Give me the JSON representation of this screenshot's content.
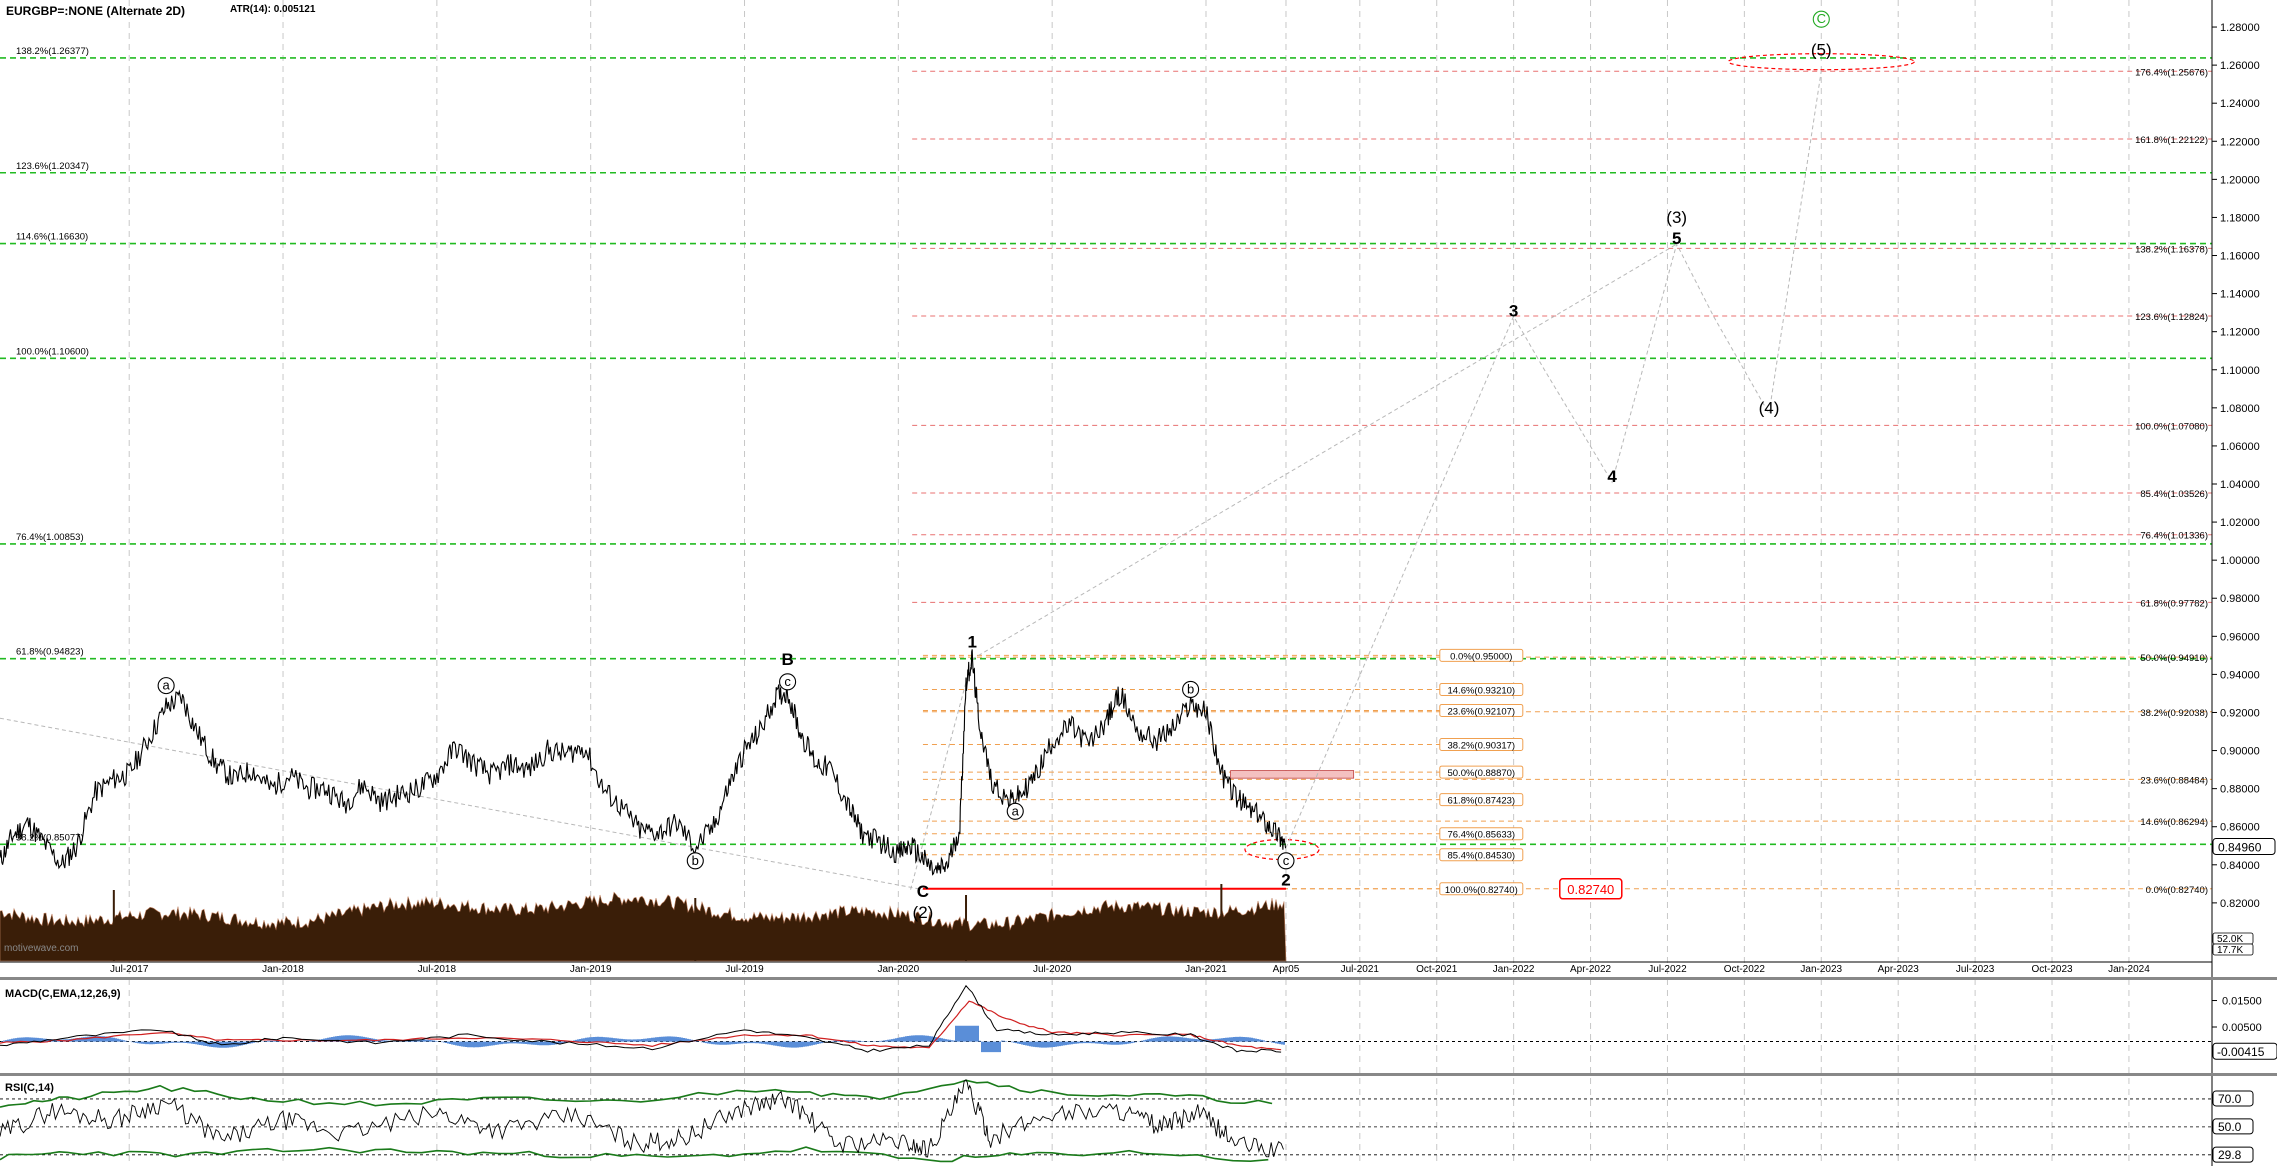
{
  "header": {
    "symbol": "EURGBP=:NONE (Alternate 2D)",
    "atr": "ATR(14): 0.005121",
    "watermark": "motivewave.com"
  },
  "chart_data": [
    {
      "type": "line",
      "panel": "price",
      "ylim": [
        0.79,
        1.29
      ],
      "y_ticks": [
        "0.82000",
        "0.84000",
        "0.86000",
        "0.88000",
        "0.90000",
        "0.92000",
        "0.94000",
        "0.96000",
        "0.98000",
        "1.00000",
        "1.02000",
        "1.04000",
        "1.06000",
        "1.08000",
        "1.10000",
        "1.12000",
        "1.14000",
        "1.16000",
        "1.18000",
        "1.20000",
        "1.22000",
        "1.24000",
        "1.26000",
        "1.28000"
      ],
      "x_ticks": [
        {
          "label": "Jul-2017",
          "t": 2017.5
        },
        {
          "label": "Jan-2018",
          "t": 2018.0
        },
        {
          "label": "Jul-2018",
          "t": 2018.5
        },
        {
          "label": "Jan-2019",
          "t": 2019.0
        },
        {
          "label": "Jul-2019",
          "t": 2019.5
        },
        {
          "label": "Jan-2020",
          "t": 2020.0
        },
        {
          "label": "Jul-2020",
          "t": 2020.5
        },
        {
          "label": "Jan-2021",
          "t": 2021.0
        },
        {
          "label": "Apr05",
          "t": 2021.26
        },
        {
          "label": "Jul-2021",
          "t": 2021.5
        },
        {
          "label": "Oct-2021",
          "t": 2021.75
        },
        {
          "label": "Jan-2022",
          "t": 2022.0
        },
        {
          "label": "Apr-2022",
          "t": 2022.25
        },
        {
          "label": "Jul-2022",
          "t": 2022.5
        },
        {
          "label": "Oct-2022",
          "t": 2022.75
        },
        {
          "label": "Jan-2023",
          "t": 2023.0
        },
        {
          "label": "Apr-2023",
          "t": 2023.25
        },
        {
          "label": "Jul-2023",
          "t": 2023.5
        },
        {
          "label": "Oct-2023",
          "t": 2023.75
        },
        {
          "label": "Jan-2024",
          "t": 2024.0
        }
      ],
      "xlim": [
        2017.08,
        2024.27
      ],
      "price_path": [
        [
          2017.08,
          0.842
        ],
        [
          2017.12,
          0.855
        ],
        [
          2017.17,
          0.862
        ],
        [
          2017.22,
          0.852
        ],
        [
          2017.28,
          0.84
        ],
        [
          2017.33,
          0.85
        ],
        [
          2017.39,
          0.878
        ],
        [
          2017.45,
          0.885
        ],
        [
          2017.5,
          0.888
        ],
        [
          2017.56,
          0.905
        ],
        [
          2017.62,
          0.923
        ],
        [
          2017.67,
          0.928
        ],
        [
          2017.72,
          0.91
        ],
        [
          2017.78,
          0.893
        ],
        [
          2017.84,
          0.885
        ],
        [
          2017.9,
          0.89
        ],
        [
          2017.96,
          0.88
        ],
        [
          2018.02,
          0.887
        ],
        [
          2018.08,
          0.88
        ],
        [
          2018.14,
          0.88
        ],
        [
          2018.2,
          0.872
        ],
        [
          2018.26,
          0.882
        ],
        [
          2018.32,
          0.873
        ],
        [
          2018.38,
          0.877
        ],
        [
          2018.44,
          0.88
        ],
        [
          2018.5,
          0.887
        ],
        [
          2018.56,
          0.902
        ],
        [
          2018.62,
          0.893
        ],
        [
          2018.68,
          0.887
        ],
        [
          2018.74,
          0.893
        ],
        [
          2018.8,
          0.89
        ],
        [
          2018.86,
          0.9
        ],
        [
          2018.92,
          0.898
        ],
        [
          2018.98,
          0.902
        ],
        [
          2019.04,
          0.88
        ],
        [
          2019.1,
          0.87
        ],
        [
          2019.16,
          0.858
        ],
        [
          2019.22,
          0.857
        ],
        [
          2019.28,
          0.862
        ],
        [
          2019.34,
          0.849
        ],
        [
          2019.4,
          0.86
        ],
        [
          2019.45,
          0.882
        ],
        [
          2019.5,
          0.9
        ],
        [
          2019.55,
          0.91
        ],
        [
          2019.6,
          0.928
        ],
        [
          2019.64,
          0.931
        ],
        [
          2019.68,
          0.91
        ],
        [
          2019.73,
          0.894
        ],
        [
          2019.78,
          0.89
        ],
        [
          2019.84,
          0.87
        ],
        [
          2019.88,
          0.857
        ],
        [
          2019.94,
          0.852
        ],
        [
          2020.0,
          0.846
        ],
        [
          2020.04,
          0.85
        ],
        [
          2020.08,
          0.843
        ],
        [
          2020.12,
          0.836
        ],
        [
          2020.16,
          0.84
        ],
        [
          2020.2,
          0.86
        ],
        [
          2020.22,
          0.936
        ],
        [
          2020.24,
          0.948
        ],
        [
          2020.26,
          0.918
        ],
        [
          2020.3,
          0.885
        ],
        [
          2020.36,
          0.873
        ],
        [
          2020.4,
          0.877
        ],
        [
          2020.45,
          0.888
        ],
        [
          2020.5,
          0.905
        ],
        [
          2020.56,
          0.913
        ],
        [
          2020.62,
          0.903
        ],
        [
          2020.68,
          0.917
        ],
        [
          2020.72,
          0.93
        ],
        [
          2020.78,
          0.91
        ],
        [
          2020.84,
          0.905
        ],
        [
          2020.9,
          0.913
        ],
        [
          2020.95,
          0.925
        ],
        [
          2021.0,
          0.92
        ],
        [
          2021.05,
          0.888
        ],
        [
          2021.1,
          0.875
        ],
        [
          2021.15,
          0.868
        ],
        [
          2021.2,
          0.862
        ],
        [
          2021.24,
          0.855
        ],
        [
          2021.26,
          0.849
        ]
      ],
      "wave_labels": [
        {
          "text": "a",
          "circled": true,
          "t": 2017.62,
          "p": 0.932
        },
        {
          "text": "b",
          "circled": true,
          "t": 2019.34,
          "p": 0.84
        },
        {
          "text": "B",
          "circled": false,
          "bold": true,
          "t": 2019.64,
          "p": 0.945
        },
        {
          "text": "c",
          "circled": true,
          "t": 2019.64,
          "p": 0.934
        },
        {
          "text": "C",
          "circled": false,
          "bold": true,
          "t": 2020.08,
          "p": 0.823
        },
        {
          "text": "(2)",
          "circled": false,
          "t": 2020.08,
          "p": 0.812
        },
        {
          "text": "1",
          "circled": false,
          "bold": true,
          "t": 2020.24,
          "p": 0.954
        },
        {
          "text": "a",
          "circled": true,
          "t": 2020.38,
          "p": 0.866
        },
        {
          "text": "b",
          "circled": true,
          "t": 2020.95,
          "p": 0.93
        },
        {
          "text": "c",
          "circled": true,
          "t": 2021.26,
          "p": 0.84
        },
        {
          "text": "2",
          "circled": false,
          "bold": true,
          "t": 2021.26,
          "p": 0.829
        },
        {
          "text": "3",
          "circled": false,
          "bold": true,
          "t": 2022.0,
          "p": 1.128
        },
        {
          "text": "4",
          "circled": false,
          "bold": true,
          "t": 2022.32,
          "p": 1.041
        },
        {
          "text": "(3)",
          "circled": false,
          "t": 2022.53,
          "p": 1.177
        },
        {
          "text": "5",
          "circled": false,
          "bold": true,
          "t": 2022.53,
          "p": 1.166
        },
        {
          "text": "(4)",
          "circled": false,
          "t": 2022.83,
          "p": 1.077
        },
        {
          "text": "(5)",
          "circled": false,
          "t": 2023.0,
          "p": 1.265
        },
        {
          "text": "C",
          "circled": true,
          "green": true,
          "t": 2023.0,
          "p": 1.282
        }
      ],
      "projection_paths": [
        [
          [
            2021.26,
            0.849
          ],
          [
            2022.0,
            1.128
          ],
          [
            2022.1,
            1.1
          ],
          [
            2022.32,
            1.041
          ],
          [
            2022.53,
            1.166
          ],
          [
            2022.65,
            1.128
          ],
          [
            2022.83,
            1.077
          ],
          [
            2023.0,
            1.257
          ]
        ],
        [
          [
            2020.24,
            0.948
          ],
          [
            2022.53,
            1.166
          ]
        ],
        [
          [
            2020.04,
            0.827
          ],
          [
            2020.24,
            0.948
          ]
        ],
        [
          [
            2017.08,
            0.917
          ],
          [
            2020.08,
            0.827
          ]
        ]
      ],
      "green_levels": [
        {
          "label": "138.2%(1.26377)",
          "value": 1.26377
        },
        {
          "label": "123.6%(1.20347)",
          "value": 1.20347
        },
        {
          "label": "114.6%(1.16630)",
          "value": 1.1663
        },
        {
          "label": "100.0%(1.10600)",
          "value": 1.106
        },
        {
          "label": "76.4%(1.00853)",
          "value": 1.00853
        },
        {
          "label": "61.8%(0.94823)",
          "value": 0.94823
        },
        {
          "label": "38.2%(0.85077)",
          "value": 0.85077
        }
      ],
      "red_levels_right": [
        {
          "label": "176.4%(1.25676)",
          "value": 1.25676
        },
        {
          "label": "161.8%(1.22122)",
          "value": 1.22122
        },
        {
          "label": "138.2%(1.16378)",
          "value": 1.16378
        },
        {
          "label": "123.6%(1.12824)",
          "value": 1.12824
        },
        {
          "label": "100.0%(1.07080)",
          "value": 1.0708
        },
        {
          "label": "85.4%(1.03526)",
          "value": 1.03526
        },
        {
          "label": "76.4%(1.01336)",
          "value": 1.01336
        },
        {
          "label": "61.8%(0.97782)",
          "value": 0.97782
        }
      ],
      "orange_levels_right": [
        {
          "label": "50.0%(0.94910)",
          "value": 0.9491
        },
        {
          "label": "38.2%(0.92038)",
          "value": 0.92038
        },
        {
          "label": "23.6%(0.88484)",
          "value": 0.88484
        },
        {
          "label": "14.6%(0.86294)",
          "value": 0.86294
        },
        {
          "label": "0.0%(0.82740)",
          "value": 0.8274
        }
      ],
      "orange_levels_mid": [
        {
          "label": "0.0%(0.95000)",
          "value": 0.95
        },
        {
          "label": "14.6%(0.93210)",
          "value": 0.9321
        },
        {
          "label": "23.6%(0.92107)",
          "value": 0.92107
        },
        {
          "label": "38.2%(0.90317)",
          "value": 0.90317
        },
        {
          "label": "50.0%(0.88870)",
          "value": 0.8887
        },
        {
          "label": "61.8%(0.87423)",
          "value": 0.87423
        },
        {
          "label": "76.4%(0.85633)",
          "value": 0.85633
        },
        {
          "label": "85.4%(0.84530)",
          "value": 0.8453
        },
        {
          "label": "100.0%(0.82740)",
          "value": 0.8274
        }
      ],
      "support_level": {
        "label": "0.82740",
        "value": 0.8274
      },
      "last_price": "0.84960",
      "volume_labels": [
        "52.0K",
        "17.7K"
      ],
      "volume_level": 0.5
    },
    {
      "type": "line",
      "panel": "macd",
      "title": "MACD(C,EMA,12,26,9)",
      "y_ticks": [
        "0.01500",
        "0.00500"
      ],
      "last_value": "-0.00415",
      "ylim": [
        -0.012,
        0.022
      ],
      "zero": -0.0005,
      "macd_path": [
        [
          2017.08,
          -0.002
        ],
        [
          2017.3,
          0.001
        ],
        [
          2017.6,
          0.004
        ],
        [
          2017.8,
          -0.002
        ],
        [
          2018.0,
          0.001
        ],
        [
          2018.3,
          -0.001
        ],
        [
          2018.6,
          0.002
        ],
        [
          2018.9,
          -0.001
        ],
        [
          2019.2,
          -0.003
        ],
        [
          2019.5,
          0.004
        ],
        [
          2019.7,
          0.001
        ],
        [
          2019.9,
          -0.004
        ],
        [
          2020.1,
          -0.002
        ],
        [
          2020.22,
          0.021
        ],
        [
          2020.32,
          0.004
        ],
        [
          2020.5,
          0.002
        ],
        [
          2020.7,
          0.003
        ],
        [
          2020.95,
          0.002
        ],
        [
          2021.1,
          -0.004
        ],
        [
          2021.26,
          -0.004
        ]
      ],
      "signal_path": [
        [
          2017.08,
          -0.001
        ],
        [
          2017.3,
          0.0
        ],
        [
          2017.6,
          0.003
        ],
        [
          2017.8,
          0.0
        ],
        [
          2018.0,
          0.0
        ],
        [
          2018.3,
          0.0
        ],
        [
          2018.6,
          0.001
        ],
        [
          2018.9,
          0.0
        ],
        [
          2019.2,
          -0.002
        ],
        [
          2019.5,
          0.002
        ],
        [
          2019.7,
          0.002
        ],
        [
          2019.9,
          -0.002
        ],
        [
          2020.1,
          -0.003
        ],
        [
          2020.23,
          0.015
        ],
        [
          2020.35,
          0.008
        ],
        [
          2020.5,
          0.003
        ],
        [
          2020.7,
          0.002
        ],
        [
          2020.95,
          0.002
        ],
        [
          2021.1,
          -0.002
        ],
        [
          2021.26,
          -0.004
        ]
      ]
    },
    {
      "type": "line",
      "panel": "rsi",
      "title": "RSI(C,14)",
      "y_ticks": [
        "70.0",
        "50.0",
        "29.8"
      ],
      "levels": [
        70,
        50,
        30
      ],
      "ylim": [
        22,
        85
      ],
      "rsi_path": [
        [
          2017.08,
          45
        ],
        [
          2017.25,
          62
        ],
        [
          2017.45,
          55
        ],
        [
          2017.62,
          68
        ],
        [
          2017.8,
          40
        ],
        [
          2018.0,
          55
        ],
        [
          2018.2,
          45
        ],
        [
          2018.5,
          60
        ],
        [
          2018.7,
          48
        ],
        [
          2018.95,
          58
        ],
        [
          2019.15,
          38
        ],
        [
          2019.3,
          42
        ],
        [
          2019.5,
          64
        ],
        [
          2019.64,
          70
        ],
        [
          2019.8,
          38
        ],
        [
          2020.0,
          40
        ],
        [
          2020.1,
          34
        ],
        [
          2020.22,
          80
        ],
        [
          2020.3,
          42
        ],
        [
          2020.5,
          60
        ],
        [
          2020.72,
          62
        ],
        [
          2020.85,
          50
        ],
        [
          2020.98,
          60
        ],
        [
          2021.1,
          38
        ],
        [
          2021.26,
          32
        ]
      ],
      "upper_band": [
        [
          2017.08,
          66
        ],
        [
          2017.3,
          70
        ],
        [
          2017.6,
          78
        ],
        [
          2017.9,
          70
        ],
        [
          2018.3,
          66
        ],
        [
          2018.7,
          70
        ],
        [
          2019.1,
          68
        ],
        [
          2019.6,
          78
        ],
        [
          2019.9,
          70
        ],
        [
          2020.22,
          84
        ],
        [
          2020.5,
          74
        ],
        [
          2020.9,
          72
        ],
        [
          2021.26,
          66
        ]
      ],
      "lower_band": [
        [
          2017.08,
          28
        ],
        [
          2017.3,
          32
        ],
        [
          2017.7,
          30
        ],
        [
          2018.1,
          34
        ],
        [
          2018.5,
          32
        ],
        [
          2018.9,
          30
        ],
        [
          2019.3,
          28
        ],
        [
          2019.7,
          34
        ],
        [
          2020.1,
          26
        ],
        [
          2020.4,
          30
        ],
        [
          2020.8,
          32
        ],
        [
          2021.26,
          24
        ]
      ]
    }
  ]
}
